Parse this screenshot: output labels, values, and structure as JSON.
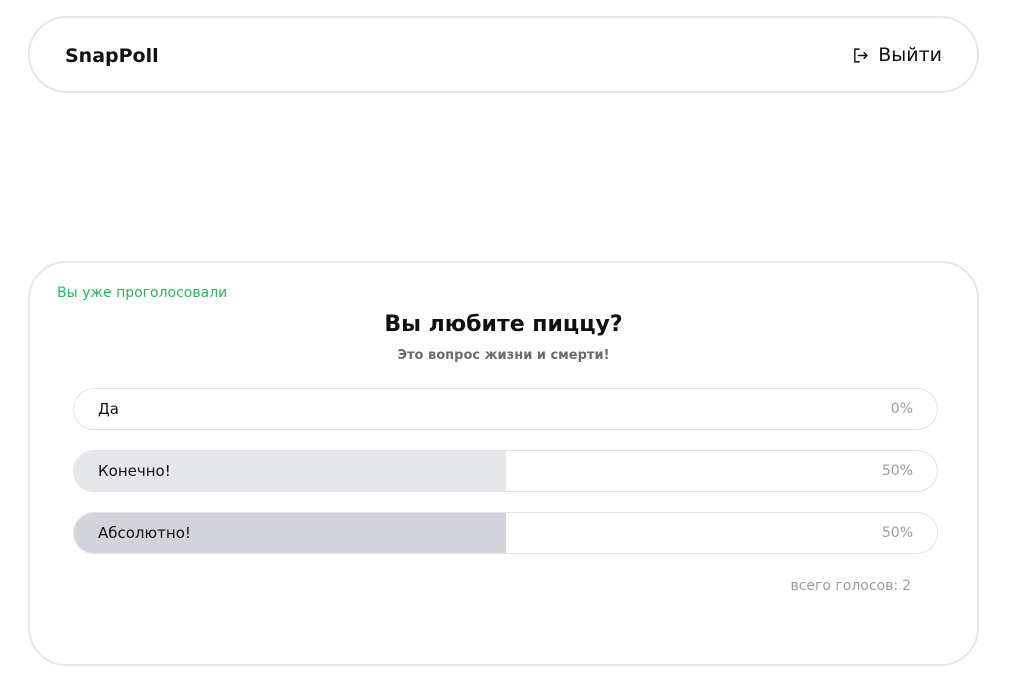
{
  "header": {
    "brand": "SnapPoll",
    "logout_label": "Выйти",
    "logout_icon": "logout-icon"
  },
  "poll": {
    "status": "Вы уже проголосовали",
    "title": "Вы любите пиццу?",
    "subtitle": "Это вопрос жизни и смерти!",
    "options": [
      {
        "label": "Да",
        "percent": "0%",
        "share": 0,
        "fill_color": "#e6e7ea"
      },
      {
        "label": "Конечно!",
        "percent": "50%",
        "share": 0.5,
        "fill_color": "#e6e7ea"
      },
      {
        "label": "Абсолютно!",
        "percent": "50%",
        "share": 0.5,
        "fill_color": "#d2d4da"
      }
    ],
    "total_label": "всего голосов:",
    "total_votes": "2"
  },
  "colors": {
    "status_green": "#2fb55e",
    "border": "#e6e6e9",
    "muted_text": "#9b9ba3"
  }
}
